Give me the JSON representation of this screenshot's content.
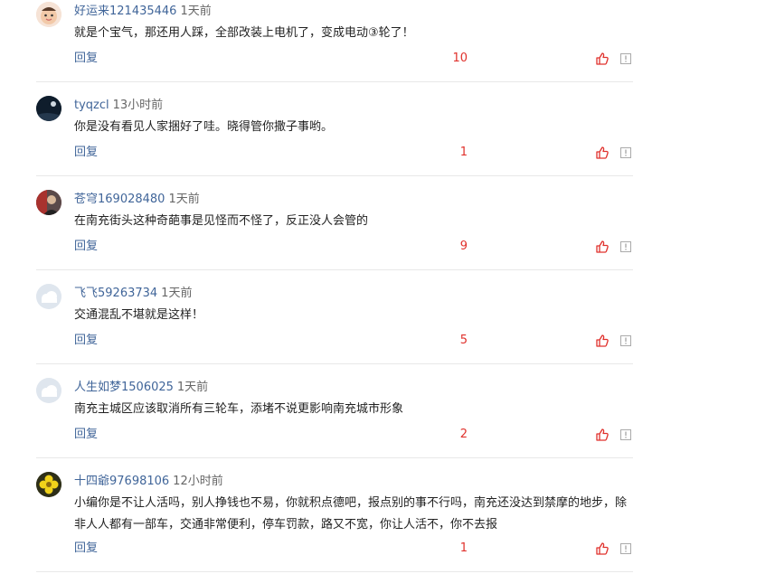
{
  "comments": [
    {
      "user": "好运来121435446",
      "time": "1天前",
      "text": "就是个宝气，那还用人踩，全部改装上电机了，变成电动③轮了！",
      "reply": "回复",
      "likes": "10",
      "avatar": "baby-face-avatar"
    },
    {
      "user": "tyqzcl",
      "time": "13小时前",
      "text": "你是没有看见人家捆好了哇。晓得管你撒子事哟。",
      "reply": "回复",
      "likes": "1",
      "avatar": "dark-night-avatar"
    },
    {
      "user": "苍穹169028480",
      "time": "1天前",
      "text": "在南充街头这种奇葩事是见怪而不怪了，反正没人会管的",
      "reply": "回复",
      "likes": "9",
      "avatar": "person-photo-avatar"
    },
    {
      "user": "飞飞59263734",
      "time": "1天前",
      "text": "交通混乱不堪就是这样！",
      "reply": "回复",
      "likes": "5",
      "avatar": "default-cloud-avatar"
    },
    {
      "user": "人生如梦1506025",
      "time": "1天前",
      "text": "南充主城区应该取消所有三轮车，添堵不说更影响南充城市形象",
      "reply": "回复",
      "likes": "2",
      "avatar": "default-cloud-avatar"
    },
    {
      "user": "十四爺97698106",
      "time": "12小时前",
      "text": "小编你是不让人活吗，别人挣钱也不易，你就积点德吧，报点别的事不行吗，南充还没达到禁摩的地步，除非人人都有一部车，交通非常便利，停车罚款，路又不宽，你让人活不，你不去报",
      "reply": "回复",
      "likes": "1",
      "avatar": "yellow-flower-avatar"
    }
  ],
  "colors": {
    "username": "#406599",
    "likes": "#e0312c",
    "divider": "#e8e8e8"
  }
}
